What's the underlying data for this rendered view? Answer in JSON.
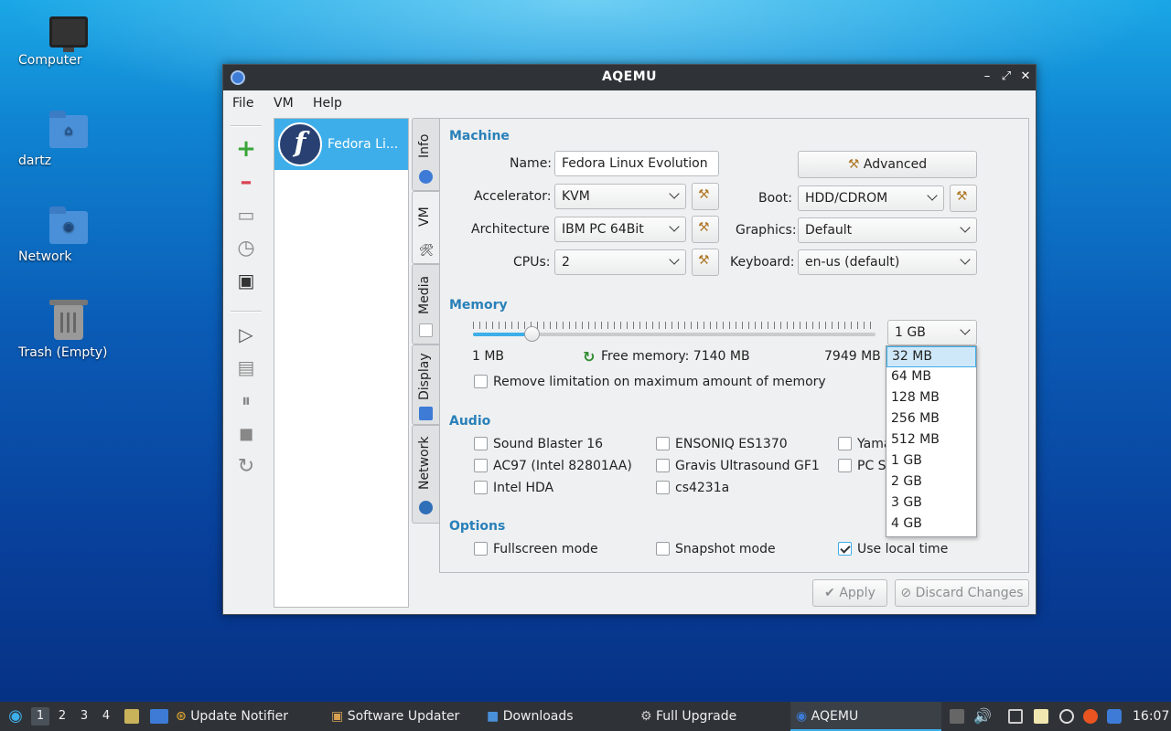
{
  "desktop": {
    "icons": [
      {
        "label": "Computer",
        "icon": "monitor-icon"
      },
      {
        "label": "dartz",
        "icon": "home-folder-icon"
      },
      {
        "label": "Network",
        "icon": "network-folder-icon"
      },
      {
        "label": "Trash (Empty)",
        "icon": "trash-icon"
      }
    ]
  },
  "window": {
    "title": "AQEMU",
    "menu": [
      "File",
      "VM",
      "Help"
    ],
    "vm_list": [
      {
        "name": "Fedora Li..."
      }
    ],
    "tabs": [
      "Info",
      "VM",
      "Media",
      "Display",
      "Network"
    ],
    "active_tab": "VM",
    "machine": {
      "section": "Machine",
      "name_label": "Name:",
      "name_value": "Fedora Linux Evolution",
      "advanced_label": "Advanced",
      "accelerator_label": "Accelerator:",
      "accelerator_value": "KVM",
      "architecture_label": "Architecture",
      "architecture_value": "IBM PC 64Bit",
      "cpus_label": "CPUs:",
      "cpus_value": "2",
      "boot_label": "Boot:",
      "boot_value": "HDD/CDROM",
      "graphics_label": "Graphics:",
      "graphics_value": "Default",
      "keyboard_label": "Keyboard:",
      "keyboard_value": "en-us (default)"
    },
    "memory": {
      "section": "Memory",
      "slider_fraction": 0.145,
      "selected": "1 GB",
      "min_label": "1 MB",
      "free_label": "Free memory: 7140 MB",
      "max_label": "7949 MB",
      "remove_limit_label": "Remove limitation on maximum amount of memory",
      "remove_limit_checked": false,
      "options": [
        "32 MB",
        "64 MB",
        "128 MB",
        "256 MB",
        "512 MB",
        "1 GB",
        "2 GB",
        "3 GB",
        "4 GB"
      ],
      "highlighted_option": "32 MB"
    },
    "audio": {
      "section": "Audio",
      "col1": [
        "Sound Blaster 16",
        "AC97 (Intel 82801AA)",
        "Intel HDA"
      ],
      "col2": [
        "ENSONIQ ES1370",
        "Gravis Ultrasound GF1",
        "cs4231a"
      ],
      "col3": [
        "Yama",
        "PC S"
      ]
    },
    "options": {
      "section": "Options",
      "fullscreen_label": "Fullscreen mode",
      "fullscreen_checked": false,
      "snapshot_label": "Snapshot mode",
      "snapshot_checked": false,
      "localtime_label": "Use local time",
      "localtime_checked": true
    },
    "apply_label": "Apply",
    "discard_label": "Discard Changes"
  },
  "taskbar": {
    "workspaces": [
      "1",
      "2",
      "3",
      "4"
    ],
    "current_workspace": "1",
    "tasks": [
      "Update Notifier",
      "Software Updater",
      "Downloads",
      "Full Upgrade",
      "AQEMU"
    ],
    "active_task": "AQEMU",
    "clock": "16:07"
  },
  "colors": {
    "accent": "#3daee9",
    "section_title": "#2980b9",
    "titlebar": "#2f3338"
  }
}
